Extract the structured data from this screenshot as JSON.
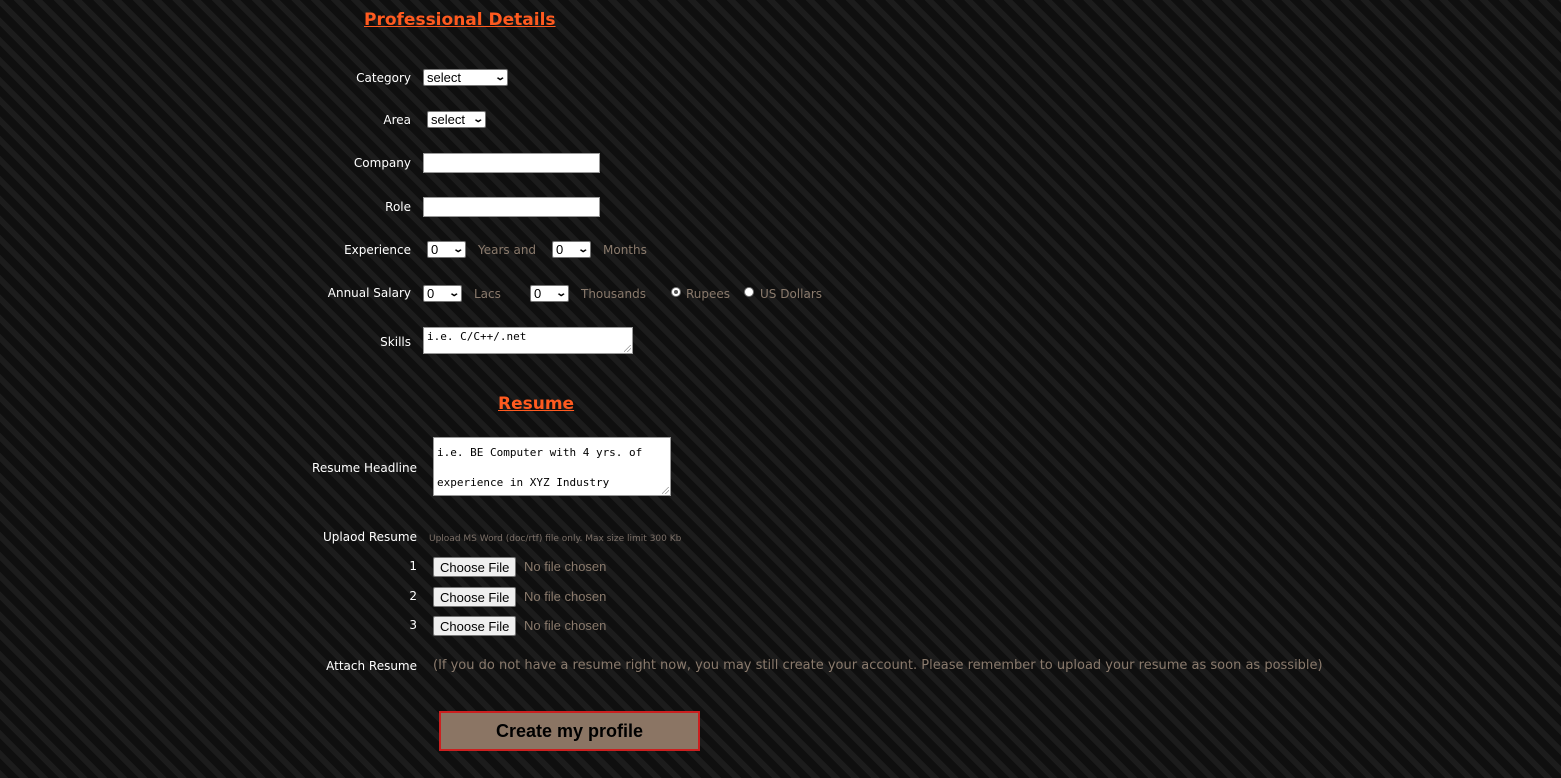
{
  "professional": {
    "title": "Professional Details",
    "category": {
      "label": "Category",
      "value": "select"
    },
    "area": {
      "label": "Area",
      "value": "select"
    },
    "company": {
      "label": "Company",
      "value": ""
    },
    "role": {
      "label": "Role",
      "value": ""
    },
    "experience": {
      "label": "Experience",
      "years_value": "0",
      "years_text": "Years and",
      "months_value": "0",
      "months_text": "Months"
    },
    "salary": {
      "label": "Annual Salary",
      "lacs_value": "0",
      "lacs_text": "Lacs",
      "thousands_value": "0",
      "thousands_text": "Thousands",
      "currency_options": [
        "Rupees",
        "US Dollars"
      ],
      "selected_currency": "Rupees"
    },
    "skills": {
      "label": "Skills",
      "value": "i.e. C/C++/.net"
    }
  },
  "resume": {
    "title": "Resume",
    "headline": {
      "label": "Resume Headline",
      "line1": "i.e. BE Computer with 4 yrs. of",
      "line2": "experience in XYZ Industry"
    },
    "upload": {
      "label": "Uplaod Resume",
      "hint": "Upload MS Word (doc/rtf) file only. Max size limit 300 Kb",
      "files": [
        {
          "number": "1",
          "button": "Choose File",
          "status": "No file chosen"
        },
        {
          "number": "2",
          "button": "Choose File",
          "status": "No file chosen"
        },
        {
          "number": "3",
          "button": "Choose File",
          "status": "No file chosen"
        }
      ]
    },
    "attach": {
      "label": "Attach Resume",
      "note": "(If you do not have a resume right now, you may still create your account. Please remember to upload your resume as soon as possible)"
    }
  },
  "submit": {
    "label": "Create my profile"
  },
  "colors": {
    "accent": "#ff5a1f",
    "muted_text": "#8a7a6c",
    "button_fill": "#8b7564",
    "button_border": "#cc1f1f"
  }
}
